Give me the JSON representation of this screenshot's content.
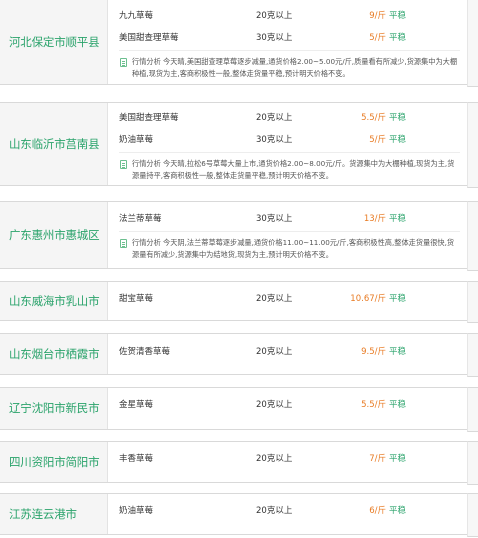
{
  "regions": [
    {
      "name": "河北保定市顺平县",
      "varieties": [
        {
          "name": "九九草莓",
          "spec": "20克以上",
          "price": "9/斤",
          "trend": "平稳"
        },
        {
          "name": "美国甜查理草莓",
          "spec": "30克以上",
          "price": "5/斤",
          "trend": "平稳"
        }
      ],
      "analysis": "行情分析 今天晴,美国甜查理草莓逐步减量,通货价格2.00~5.00元/斤,质量看有所减少,货源集中为大棚种植,现货为主,客商积极性一般,整体走货量平稳,预计明天价格不变。"
    },
    {
      "name": "山东临沂市莒南县",
      "varieties": [
        {
          "name": "美国甜查理草莓",
          "spec": "20克以上",
          "price": "5.5/斤",
          "trend": "平稳"
        },
        {
          "name": "奶油草莓",
          "spec": "30克以上",
          "price": "5/斤",
          "trend": "平稳"
        }
      ],
      "analysis": "行情分析 今天晴,拉松6号草莓大量上市,通货价格2.00~8.00元/斤。货源集中为大棚种植,现货为主,货源量持平,客商积极性一般,整体走货量平稳,预计明天价格不变。"
    },
    {
      "name": "广东惠州市惠城区",
      "varieties": [
        {
          "name": "法兰蒂草莓",
          "spec": "30克以上",
          "price": "13/斤",
          "trend": "平稳"
        }
      ],
      "analysis": "行情分析 今天阴,法兰蒂草莓逐步减量,通货价格11.00~11.00元/斤,客商积极性高,整体走货量很快,货源量有所减少,货源集中为结地货,现货为主,预计明天价格不变。"
    },
    {
      "name": "山东威海市乳山市",
      "varieties": [
        {
          "name": "甜宝草莓",
          "spec": "20克以上",
          "price": "10.67/斤",
          "trend": "平稳"
        }
      ],
      "analysis": ""
    },
    {
      "name": "山东烟台市栖霞市",
      "varieties": [
        {
          "name": "佐贺清香草莓",
          "spec": "20克以上",
          "price": "9.5/斤",
          "trend": "平稳"
        }
      ],
      "analysis": ""
    },
    {
      "name": "辽宁沈阳市新民市",
      "varieties": [
        {
          "name": "金星草莓",
          "spec": "20克以上",
          "price": "5.5/斤",
          "trend": "平稳"
        }
      ],
      "analysis": ""
    },
    {
      "name": "四川资阳市简阳市",
      "varieties": [
        {
          "name": "丰香草莓",
          "spec": "20克以上",
          "price": "7/斤",
          "trend": "平稳"
        }
      ],
      "analysis": ""
    },
    {
      "name": "江苏连云港市",
      "varieties": [
        {
          "name": "奶油草莓",
          "spec": "20克以上",
          "price": "6/斤",
          "trend": "平稳"
        }
      ],
      "analysis": ""
    }
  ]
}
